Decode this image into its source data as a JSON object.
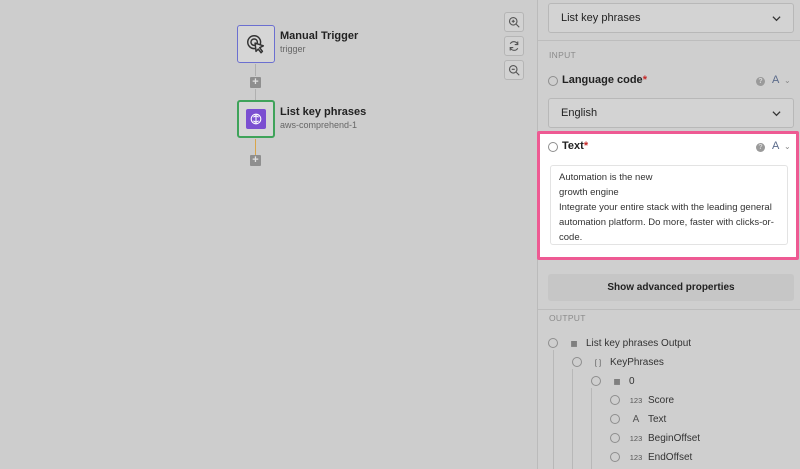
{
  "canvas": {
    "nodes": [
      {
        "title": "Manual Trigger",
        "subtitle": "trigger",
        "icon": "cursor-click-icon",
        "border_color": "#6b6fd0"
      },
      {
        "title": "List key phrases",
        "subtitle": "aws-comprehend-1",
        "icon": "aws-comprehend-icon",
        "border_color": "#3fa35a",
        "icon_bg": "#7b4fd1"
      }
    ],
    "add_step_label": "+",
    "zoom": {
      "zoom_in": "zoom-in-icon",
      "reset": "refresh-icon",
      "zoom_out": "zoom-out-icon"
    }
  },
  "panel": {
    "action_select": {
      "value": "List key phrases"
    },
    "input_section": "INPUT",
    "language": {
      "label": "Language code",
      "required_mark": "*",
      "help": "?",
      "type": "A",
      "value": "English"
    },
    "text_field": {
      "label": "Text",
      "required_mark": "*",
      "help": "?",
      "type": "A",
      "lines": [
        "Automation is the new",
        "growth engine",
        "Integrate your entire stack with the leading general",
        "automation platform. Do more, faster with clicks-or-",
        "code."
      ]
    },
    "advanced_button": "Show advanced properties",
    "output_section": "OUTPUT",
    "output_tree": [
      {
        "label": "List key phrases Output",
        "glyph": "▦",
        "depth": 0
      },
      {
        "label": "KeyPhrases",
        "glyph": "[ ]",
        "depth": 1
      },
      {
        "label": "0",
        "glyph": "▦",
        "depth": 2
      },
      {
        "label": "Score",
        "glyph": "123",
        "depth": 3
      },
      {
        "label": "Text",
        "glyph": "A",
        "depth": 3
      },
      {
        "label": "BeginOffset",
        "glyph": "123",
        "depth": 3
      },
      {
        "label": "EndOffset",
        "glyph": "123",
        "depth": 3
      }
    ]
  },
  "colors": {
    "highlight": "#ee5a93",
    "required": "#c62828"
  }
}
